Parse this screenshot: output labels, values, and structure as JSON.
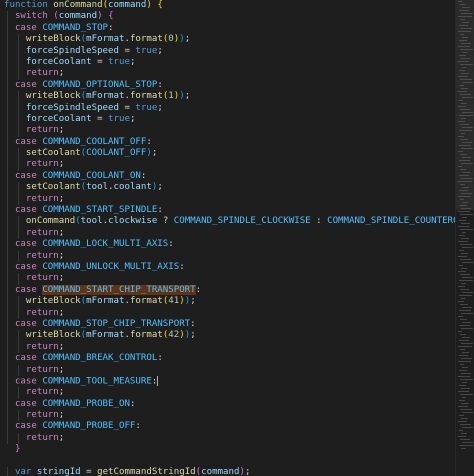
{
  "editor": {
    "lines": [
      [
        [
          "kw",
          "function "
        ],
        [
          "fn",
          "onCommand"
        ],
        [
          "brk1",
          "("
        ],
        [
          "var",
          "command"
        ],
        [
          "brk1",
          ")"
        ],
        [
          "pun",
          " "
        ],
        [
          "brk1",
          "{"
        ]
      ],
      [
        [
          "pun",
          "  "
        ],
        [
          "ctl",
          "switch "
        ],
        [
          "brk2",
          "("
        ],
        [
          "var",
          "command"
        ],
        [
          "brk2",
          ")"
        ],
        [
          "pun",
          " "
        ],
        [
          "brk2",
          "{"
        ]
      ],
      [
        [
          "pun",
          "  "
        ],
        [
          "ctl",
          "case "
        ],
        [
          "const",
          "COMMAND_STOP"
        ],
        [
          "pun",
          ":"
        ]
      ],
      [
        [
          "pun",
          "    "
        ],
        [
          "fn",
          "writeBlock"
        ],
        [
          "brk3",
          "("
        ],
        [
          "var",
          "mFormat"
        ],
        [
          "pun",
          "."
        ],
        [
          "fn",
          "format"
        ],
        [
          "brk1",
          "("
        ],
        [
          "num",
          "0"
        ],
        [
          "brk1",
          ")"
        ],
        [
          "brk3",
          ")"
        ],
        [
          "pun",
          ";"
        ]
      ],
      [
        [
          "pun",
          "    "
        ],
        [
          "var",
          "forceSpindleSpeed"
        ],
        [
          "pun",
          " = "
        ],
        [
          "kw",
          "true"
        ],
        [
          "pun",
          ";"
        ]
      ],
      [
        [
          "pun",
          "    "
        ],
        [
          "var",
          "forceCoolant"
        ],
        [
          "pun",
          " = "
        ],
        [
          "kw",
          "true"
        ],
        [
          "pun",
          ";"
        ]
      ],
      [
        [
          "pun",
          "    "
        ],
        [
          "ctl",
          "return"
        ],
        [
          "pun",
          ";"
        ]
      ],
      [
        [
          "pun",
          "  "
        ],
        [
          "ctl",
          "case "
        ],
        [
          "const",
          "COMMAND_OPTIONAL_STOP"
        ],
        [
          "pun",
          ":"
        ]
      ],
      [
        [
          "pun",
          "    "
        ],
        [
          "fn",
          "writeBlock"
        ],
        [
          "brk3",
          "("
        ],
        [
          "var",
          "mFormat"
        ],
        [
          "pun",
          "."
        ],
        [
          "fn",
          "format"
        ],
        [
          "brk1",
          "("
        ],
        [
          "num",
          "1"
        ],
        [
          "brk1",
          ")"
        ],
        [
          "brk3",
          ")"
        ],
        [
          "pun",
          ";"
        ]
      ],
      [
        [
          "pun",
          "    "
        ],
        [
          "var",
          "forceSpindleSpeed"
        ],
        [
          "pun",
          " = "
        ],
        [
          "kw",
          "true"
        ],
        [
          "pun",
          ";"
        ]
      ],
      [
        [
          "pun",
          "    "
        ],
        [
          "var",
          "forceCoolant"
        ],
        [
          "pun",
          " = "
        ],
        [
          "kw",
          "true"
        ],
        [
          "pun",
          ";"
        ]
      ],
      [
        [
          "pun",
          "    "
        ],
        [
          "ctl",
          "return"
        ],
        [
          "pun",
          ";"
        ]
      ],
      [
        [
          "pun",
          "  "
        ],
        [
          "ctl",
          "case "
        ],
        [
          "const",
          "COMMAND_COOLANT_OFF"
        ],
        [
          "pun",
          ":"
        ]
      ],
      [
        [
          "pun",
          "    "
        ],
        [
          "fn",
          "setCoolant"
        ],
        [
          "brk3",
          "("
        ],
        [
          "const",
          "COOLANT_OFF"
        ],
        [
          "brk3",
          ")"
        ],
        [
          "pun",
          ";"
        ]
      ],
      [
        [
          "pun",
          "    "
        ],
        [
          "ctl",
          "return"
        ],
        [
          "pun",
          ";"
        ]
      ],
      [
        [
          "pun",
          "  "
        ],
        [
          "ctl",
          "case "
        ],
        [
          "const",
          "COMMAND_COOLANT_ON"
        ],
        [
          "pun",
          ":"
        ]
      ],
      [
        [
          "pun",
          "    "
        ],
        [
          "fn",
          "setCoolant"
        ],
        [
          "brk3",
          "("
        ],
        [
          "var",
          "tool"
        ],
        [
          "pun",
          "."
        ],
        [
          "var",
          "coolant"
        ],
        [
          "brk3",
          ")"
        ],
        [
          "pun",
          ";"
        ]
      ],
      [
        [
          "pun",
          "    "
        ],
        [
          "ctl",
          "return"
        ],
        [
          "pun",
          ";"
        ]
      ],
      [
        [
          "pun",
          "  "
        ],
        [
          "ctl",
          "case "
        ],
        [
          "const",
          "COMMAND_START_SPINDLE"
        ],
        [
          "pun",
          ":"
        ]
      ],
      [
        [
          "pun",
          "    "
        ],
        [
          "fn",
          "onCommand"
        ],
        [
          "brk3",
          "("
        ],
        [
          "var",
          "tool"
        ],
        [
          "pun",
          "."
        ],
        [
          "var",
          "clockwise"
        ],
        [
          "pun",
          " ? "
        ],
        [
          "const",
          "COMMAND_SPINDLE_CLOCKWISE"
        ],
        [
          "pun",
          " : "
        ],
        [
          "const",
          "COMMAND_SPINDLE_COUNTERCLOCKWISE"
        ],
        [
          "brk3",
          ")"
        ],
        [
          "pun",
          ";"
        ]
      ],
      [
        [
          "pun",
          "    "
        ],
        [
          "ctl",
          "return"
        ],
        [
          "pun",
          ";"
        ]
      ],
      [
        [
          "pun",
          "  "
        ],
        [
          "ctl",
          "case "
        ],
        [
          "const",
          "COMMAND_LOCK_MULTI_AXIS"
        ],
        [
          "pun",
          ":"
        ]
      ],
      [
        [
          "pun",
          "    "
        ],
        [
          "ctl",
          "return"
        ],
        [
          "pun",
          ";"
        ]
      ],
      [
        [
          "pun",
          "  "
        ],
        [
          "ctl",
          "case "
        ],
        [
          "const",
          "COMMAND_UNLOCK_MULTI_AXIS"
        ],
        [
          "pun",
          ":"
        ]
      ],
      [
        [
          "pun",
          "    "
        ],
        [
          "ctl",
          "return"
        ],
        [
          "pun",
          ";"
        ]
      ],
      [
        [
          "pun",
          "  "
        ],
        [
          "ctl",
          "case "
        ],
        [
          "const hl-sel",
          "COMMAND_START_CHIP_TRANSPORT"
        ],
        [
          "pun",
          ":"
        ]
      ],
      [
        [
          "pun",
          "    "
        ],
        [
          "fn",
          "writeBlock"
        ],
        [
          "brk3",
          "("
        ],
        [
          "var",
          "mFormat"
        ],
        [
          "pun",
          "."
        ],
        [
          "fn",
          "format"
        ],
        [
          "brk1",
          "("
        ],
        [
          "num",
          "41"
        ],
        [
          "brk1",
          ")"
        ],
        [
          "brk3",
          ")"
        ],
        [
          "pun",
          ";"
        ]
      ],
      [
        [
          "pun",
          "    "
        ],
        [
          "ctl",
          "return"
        ],
        [
          "pun",
          ";"
        ]
      ],
      [
        [
          "pun",
          "  "
        ],
        [
          "ctl",
          "case "
        ],
        [
          "const",
          "COMMAND_STOP_CHIP_TRANSPORT"
        ],
        [
          "pun",
          ":"
        ]
      ],
      [
        [
          "pun",
          "    "
        ],
        [
          "fn",
          "writeBlock"
        ],
        [
          "brk3",
          "("
        ],
        [
          "var",
          "mFormat"
        ],
        [
          "pun",
          "."
        ],
        [
          "fn",
          "format"
        ],
        [
          "brk1",
          "("
        ],
        [
          "num",
          "42"
        ],
        [
          "brk1",
          ")"
        ],
        [
          "brk3",
          ")"
        ],
        [
          "pun",
          ";"
        ]
      ],
      [
        [
          "pun",
          "    "
        ],
        [
          "ctl",
          "return"
        ],
        [
          "pun",
          ";"
        ]
      ],
      [
        [
          "pun",
          "  "
        ],
        [
          "ctl",
          "case "
        ],
        [
          "const",
          "COMMAND_BREAK_CONTROL"
        ],
        [
          "pun",
          ":"
        ]
      ],
      [
        [
          "pun",
          "    "
        ],
        [
          "ctl",
          "return"
        ],
        [
          "pun",
          ";"
        ]
      ],
      [
        [
          "pun",
          "  "
        ],
        [
          "ctl",
          "case "
        ],
        [
          "const",
          "COMMAND_TOOL_MEASURE"
        ],
        [
          "pun",
          ":"
        ],
        [
          "cursor",
          ""
        ]
      ],
      [
        [
          "pun",
          "    "
        ],
        [
          "ctl",
          "return"
        ],
        [
          "pun",
          ";"
        ]
      ],
      [
        [
          "pun",
          "  "
        ],
        [
          "ctl",
          "case "
        ],
        [
          "const",
          "COMMAND_PROBE_ON"
        ],
        [
          "pun",
          ":"
        ]
      ],
      [
        [
          "pun",
          "    "
        ],
        [
          "ctl",
          "return"
        ],
        [
          "pun",
          ";"
        ]
      ],
      [
        [
          "pun",
          "  "
        ],
        [
          "ctl",
          "case "
        ],
        [
          "const",
          "COMMAND_PROBE_OFF"
        ],
        [
          "pun",
          ":"
        ]
      ],
      [
        [
          "pun",
          "    "
        ],
        [
          "ctl",
          "return"
        ],
        [
          "pun",
          ";"
        ]
      ],
      [
        [
          "brk2",
          "  }"
        ]
      ],
      [
        [
          "pun",
          ""
        ]
      ],
      [
        [
          "pun",
          "  "
        ],
        [
          "kw",
          "var "
        ],
        [
          "var",
          "stringId"
        ],
        [
          "pun",
          " = "
        ],
        [
          "fn",
          "getCommandStringId"
        ],
        [
          "brk2",
          "("
        ],
        [
          "var",
          "command"
        ],
        [
          "brk2",
          ")"
        ],
        [
          "pun",
          ";"
        ]
      ]
    ]
  }
}
